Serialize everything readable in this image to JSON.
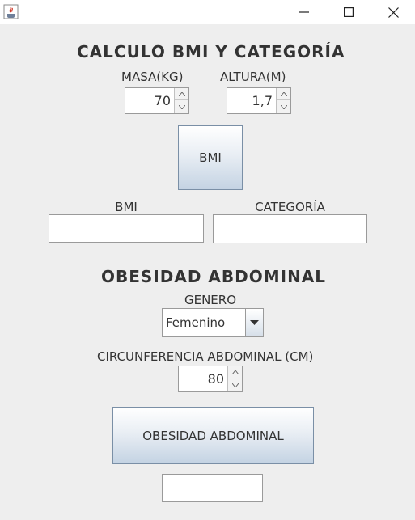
{
  "window": {
    "app_icon": "java-cup-icon",
    "controls": [
      "minimize-icon",
      "maximize-icon",
      "close-icon"
    ]
  },
  "bmi_section": {
    "title": "CALCULO BMI Y CATEGORÍA",
    "mass_label": "MASA(KG)",
    "mass_value": "70",
    "height_label": "ALTURA(M)",
    "height_value": "1,7",
    "bmi_button": "BMI",
    "bmi_result_label": "BMI",
    "bmi_result_value": "",
    "category_label": "CATEGORÍA",
    "category_value": ""
  },
  "obesity_section": {
    "title": "OBESIDAD ABDOMINAL",
    "gender_label": "GENERO",
    "gender_selected": "Femenino",
    "circumference_label": "CIRCUNFERENCIA ABDOMINAL (CM)",
    "circumference_value": "80",
    "obesity_button": "OBESIDAD ABDOMINAL",
    "result_value": ""
  },
  "colors": {
    "background": "#eeeeee",
    "button_gradient_bottom": "#c4d3e3",
    "text": "#333333"
  }
}
